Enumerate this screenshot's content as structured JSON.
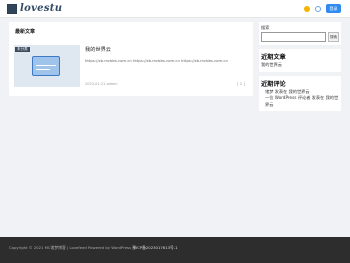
{
  "header": {
    "logo_text": "lovestu",
    "icons": [
      "sun-icon",
      "search-icon"
    ],
    "login_label": "登录",
    "accent_color": "#2f8bf0"
  },
  "main": {
    "section_title": "最新文章",
    "posts": [
      {
        "badge": "未分类",
        "title": "我的世界云",
        "excerpt": "https://zb.mcbbs.com.cn https://zb.mcbbs.com.cn https://zb.mcbbs.com.cn",
        "meta": "2023-01-21 admin",
        "comments": "[ 2 ]"
      }
    ]
  },
  "sidebar": {
    "search_label": "搜索",
    "search_value": "",
    "search_button": "搜索",
    "recent_posts_title": "近期文章",
    "recent_posts": [
      "我的世界云"
    ],
    "recent_comments_title": "近期评论",
    "recent_comments": [
      "诸梦 发表在 我的世界云",
      "一位 WordPress 评论者 发表在 我的世界云"
    ]
  },
  "footer": {
    "copyright": "Copyright © 2021 MC诸梦博客 | Lovefeed Powered by WordPress",
    "icp": "豫ICP备2023017613号-1"
  }
}
